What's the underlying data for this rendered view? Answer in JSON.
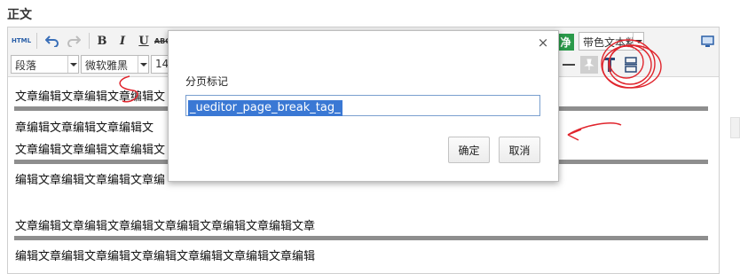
{
  "section": {
    "title": "正文"
  },
  "toolbar": {
    "html_label": "HTML",
    "bold_label": "B",
    "italic_label": "I",
    "underline_label": "U",
    "strike_label": "ABC",
    "paragraph_value": "段落",
    "font_value": "微软雅黑",
    "size_value": "14p",
    "clear_format_label": "净",
    "paste_mode_value": "带色文本粘"
  },
  "content": {
    "lines": [
      "文章编辑文章编辑文章编辑文",
      "章编辑文章编辑文章编辑文",
      "文章编辑文章编辑文章编辑文",
      "编辑文章编辑文章编辑文章编",
      "文章编辑文章编辑文章编辑文章编辑文章编辑文章编辑文章",
      "编辑文章编辑文章编辑文章编辑文章编辑文章编辑文章编辑"
    ]
  },
  "dialog": {
    "close_symbol": "×",
    "label": "分页标记",
    "input_value": "_ueditor_page_break_tag_",
    "ok_label": "确定",
    "cancel_label": "取消"
  },
  "colors": {
    "annotation_red": "#e0242c",
    "selection_blue": "#3a78d4",
    "page_break_gray": "#8e8e8e",
    "clear_format_green": "#2a9a4a"
  }
}
